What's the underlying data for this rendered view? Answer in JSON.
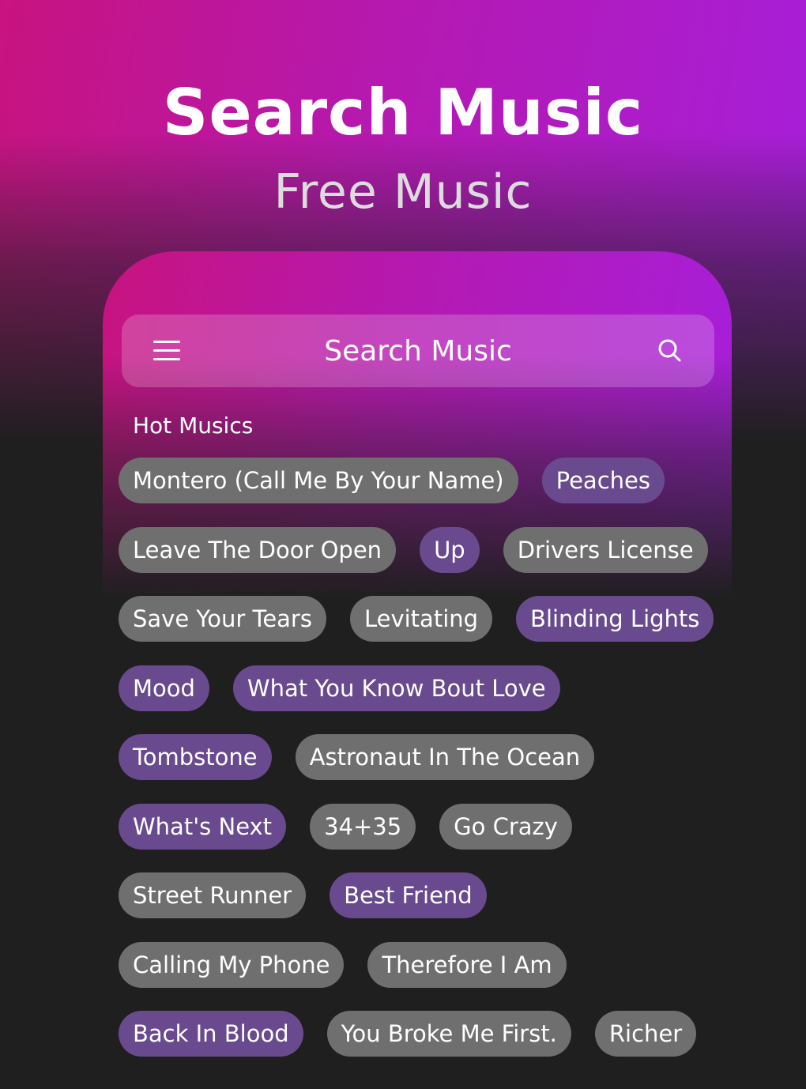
{
  "hero": {
    "title": "Search Music",
    "subtitle": "Free Music"
  },
  "toolbar": {
    "menu_icon": "hamburger-menu-icon",
    "title": "Search Music",
    "search_icon": "search-icon"
  },
  "section": {
    "label": "Hot Musics"
  },
  "colors": {
    "gradient_start": "#c8137f",
    "gradient_end": "#a61fdc",
    "background": "#1f1f1f",
    "tag_gray": "#6f6f6f",
    "tag_purple": "#6a4a8e"
  },
  "tag_rows": [
    [
      {
        "label": "Montero (Call Me By Your Name)",
        "style": "gray"
      },
      {
        "label": "Peaches",
        "style": "purple"
      }
    ],
    [
      {
        "label": "Leave The Door Open",
        "style": "gray"
      },
      {
        "label": "Up",
        "style": "purple"
      },
      {
        "label": "Drivers License",
        "style": "gray"
      }
    ],
    [
      {
        "label": "Save Your Tears",
        "style": "gray"
      },
      {
        "label": "Levitating",
        "style": "gray"
      },
      {
        "label": "Blinding Lights",
        "style": "purple"
      }
    ],
    [
      {
        "label": "Mood",
        "style": "purple"
      },
      {
        "label": "What You Know Bout Love",
        "style": "purple"
      }
    ],
    [
      {
        "label": "Tombstone",
        "style": "purple"
      },
      {
        "label": "Astronaut In The Ocean",
        "style": "gray"
      }
    ],
    [
      {
        "label": "What's Next",
        "style": "purple"
      },
      {
        "label": "34+35",
        "style": "gray"
      },
      {
        "label": "Go Crazy",
        "style": "gray"
      }
    ],
    [
      {
        "label": "Street Runner",
        "style": "gray"
      },
      {
        "label": "Best Friend",
        "style": "purple"
      }
    ],
    [
      {
        "label": "Calling My Phone",
        "style": "gray"
      },
      {
        "label": "Therefore I Am",
        "style": "gray"
      }
    ],
    [
      {
        "label": "Back In Blood",
        "style": "purple"
      },
      {
        "label": "You Broke Me First.",
        "style": "gray"
      },
      {
        "label": "Richer",
        "style": "gray"
      }
    ]
  ]
}
